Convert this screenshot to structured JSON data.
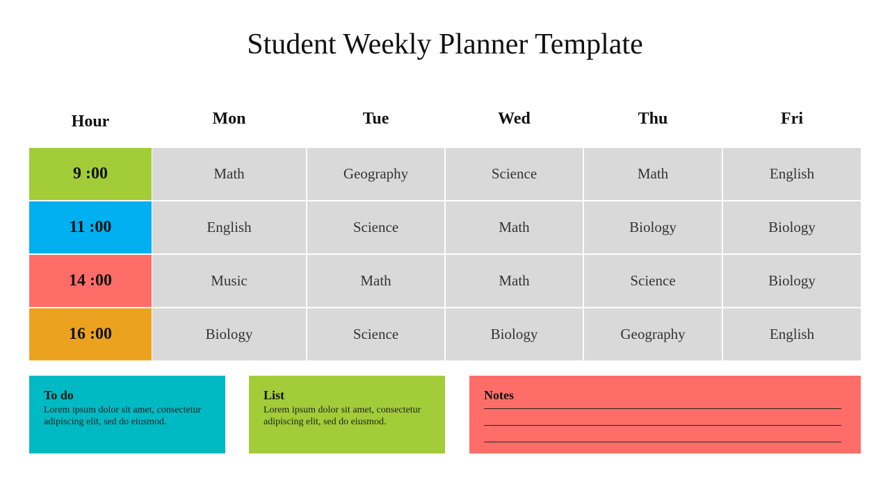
{
  "title": "Student Weekly Planner Template",
  "headers": {
    "hour": "Hour",
    "days": [
      "Mon",
      "Tue",
      "Wed",
      "Thu",
      "Fri"
    ]
  },
  "rows": [
    {
      "hour": "9 :00",
      "color": "#a2cc38",
      "subjects": [
        "Math",
        "Geography",
        "Science",
        "Math",
        "English"
      ]
    },
    {
      "hour": "11 :00",
      "color": "#00b0f0",
      "subjects": [
        "English",
        "Science",
        "Math",
        "Biology",
        "Biology"
      ]
    },
    {
      "hour": "14 :00",
      "color": "#ff6d69",
      "subjects": [
        "Music",
        "Math",
        "Math",
        "Science",
        "Biology"
      ]
    },
    {
      "hour": "16 :00",
      "color": "#eba31f",
      "subjects": [
        "Biology",
        "Science",
        "Biology",
        "Geography",
        "English"
      ]
    }
  ],
  "todo": {
    "title": "To do",
    "text": "Lorem ipsum dolor sit amet, consectetur adipiscing elit, sed do eiusmod.",
    "color": "#00bac3"
  },
  "list": {
    "title": "List",
    "text": "Lorem ipsum dolor sit amet, consectetur adipiscing elit, sed do eiusmod.",
    "color": "#a2cc38"
  },
  "notes": {
    "title": "Notes",
    "lines": 3,
    "color": "#ff6d69"
  }
}
